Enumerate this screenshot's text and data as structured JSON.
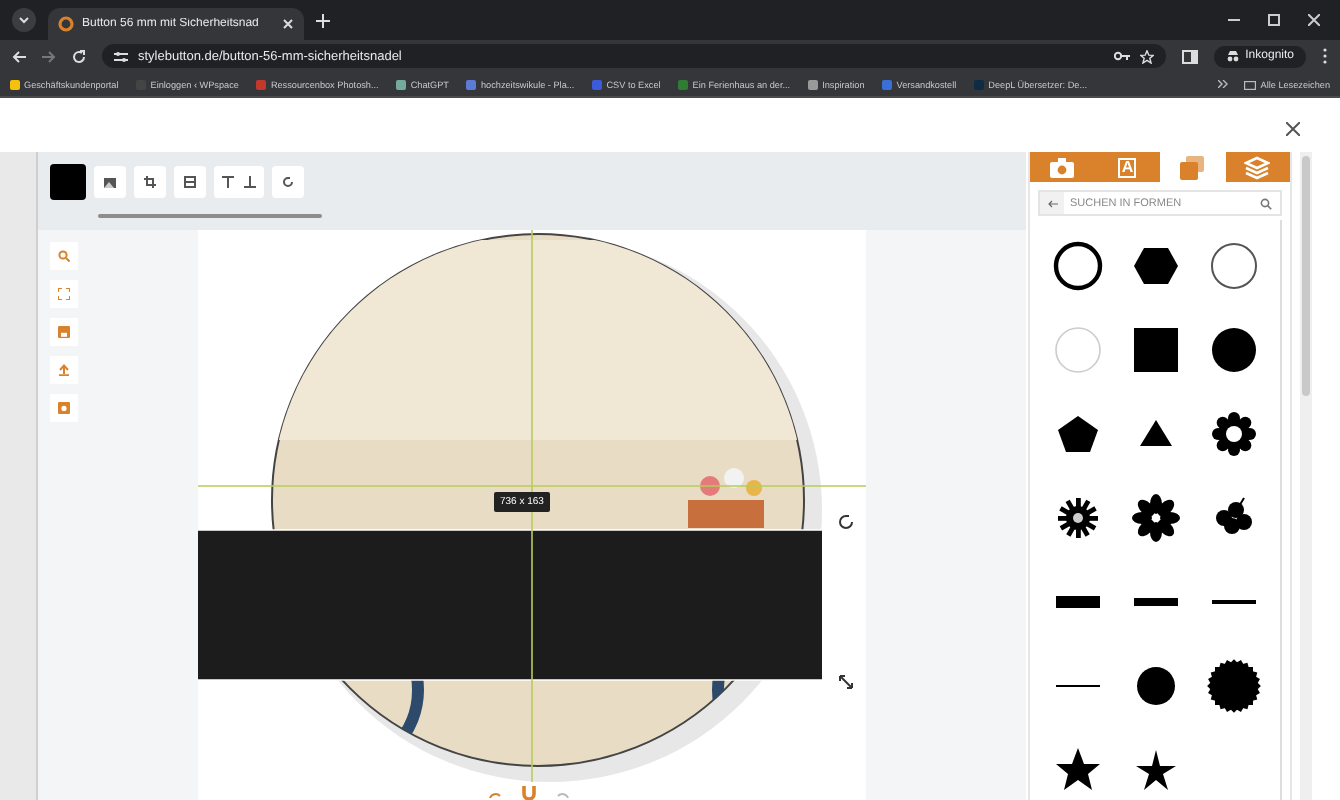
{
  "browser": {
    "tabs": [
      {
        "title": "Button 56 mm mit Sicherheitsnad",
        "selected": true
      }
    ],
    "url": "stylebutton.de/button-56-mm-sicherheitsnadel",
    "profile": "Inkognito",
    "bookmarks": [
      "Geschäftskundenportal",
      "Einloggen ‹ WPspace",
      "Ressourcenbox Photosh...",
      "ChatGPT",
      "hochzeitswikule - Pla...",
      "CSV to Excel",
      "Ein Ferienhaus an der...",
      "Inspiration",
      "Versandkostell",
      "DeepL Übersetzer: De..."
    ],
    "all_bookmarks": "Alle Lesezeichen"
  },
  "editor": {
    "size_label": "736 x 163",
    "panel_tabs": [
      {
        "kind": "camera",
        "selected": false
      },
      {
        "kind": "text",
        "glyph": "A",
        "selected": false
      },
      {
        "kind": "images",
        "selected": true
      },
      {
        "kind": "layers",
        "selected": false
      }
    ],
    "search": {
      "placeholder": "SUCHEN IN FORMEN"
    },
    "shapes": [
      {
        "kind": "ring-thick"
      },
      {
        "kind": "hexagon"
      },
      {
        "kind": "ring"
      },
      {
        "kind": "ring-thin"
      },
      {
        "kind": "square"
      },
      {
        "kind": "circle"
      },
      {
        "kind": "pentagon"
      },
      {
        "kind": "triangle"
      },
      {
        "kind": "gear"
      },
      {
        "kind": "flower-spiky"
      },
      {
        "kind": "flower"
      },
      {
        "kind": "hibiscus"
      },
      {
        "kind": "bar-thick"
      },
      {
        "kind": "bar"
      },
      {
        "kind": "line"
      },
      {
        "kind": "line-thin"
      },
      {
        "kind": "circle-small"
      },
      {
        "kind": "seal"
      },
      {
        "kind": "star"
      },
      {
        "kind": "star-thin"
      }
    ]
  }
}
